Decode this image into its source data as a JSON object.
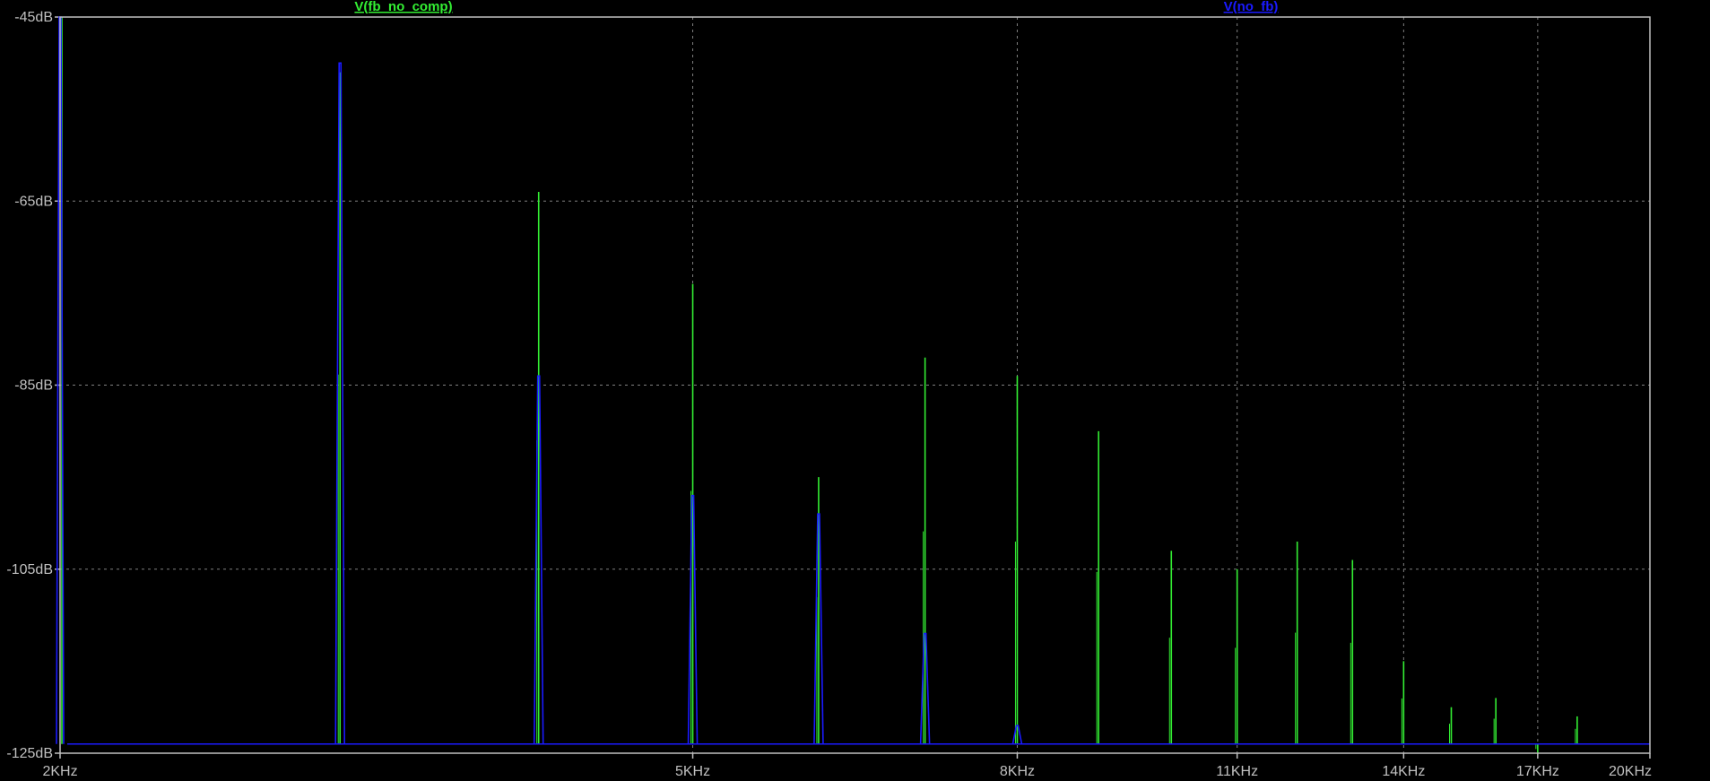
{
  "chart_data": {
    "type": "line",
    "title": "",
    "xlabel": "",
    "ylabel": "",
    "x_scale": "log",
    "xlim": [
      2000,
      20000
    ],
    "ylim": [
      -125,
      -45
    ],
    "y_unit": "dB",
    "grid": true,
    "legend_placement": "top",
    "background": "#000000",
    "grid_color": "#808080",
    "frame_color": "#c0c0c0",
    "noise_floor_db": -124,
    "x_ticks": [
      {
        "value": 2000,
        "label": "2KHz"
      },
      {
        "value": 5000,
        "label": "5KHz"
      },
      {
        "value": 8000,
        "label": "8KHz"
      },
      {
        "value": 11000,
        "label": "11KHz"
      },
      {
        "value": 14000,
        "label": "14KHz"
      },
      {
        "value": 17000,
        "label": "17KHz"
      },
      {
        "value": 20000,
        "label": "20KHz"
      }
    ],
    "y_ticks": [
      {
        "value": -45,
        "label": "-45dB"
      },
      {
        "value": -65,
        "label": "-65dB"
      },
      {
        "value": -85,
        "label": "-85dB"
      },
      {
        "value": -105,
        "label": "-105dB"
      },
      {
        "value": -125,
        "label": "-125dB"
      }
    ],
    "series": [
      {
        "name": "V(fb_no_comp)",
        "color": "#33ee33",
        "peaks": [
          {
            "x": 2000,
            "y": -45
          },
          {
            "x": 3000,
            "y": -51
          },
          {
            "x": 4000,
            "y": -64
          },
          {
            "x": 5000,
            "y": -74
          },
          {
            "x": 6000,
            "y": -95
          },
          {
            "x": 7000,
            "y": -82
          },
          {
            "x": 8000,
            "y": -84
          },
          {
            "x": 9000,
            "y": -90
          },
          {
            "x": 10000,
            "y": -103
          },
          {
            "x": 11000,
            "y": -105
          },
          {
            "x": 12000,
            "y": -102
          },
          {
            "x": 13000,
            "y": -104
          },
          {
            "x": 14000,
            "y": -115
          },
          {
            "x": 15000,
            "y": -120
          },
          {
            "x": 16000,
            "y": -119
          },
          {
            "x": 17000,
            "y": -125
          },
          {
            "x": 18000,
            "y": -121
          },
          {
            "x": 19000,
            "y": -124
          }
        ]
      },
      {
        "name": "V(no_fb)",
        "color": "#1a1aff",
        "peaks": [
          {
            "x": 2000,
            "y": -45
          },
          {
            "x": 3000,
            "y": -50
          },
          {
            "x": 4000,
            "y": -84
          },
          {
            "x": 5000,
            "y": -97
          },
          {
            "x": 6000,
            "y": -99
          },
          {
            "x": 7000,
            "y": -112
          },
          {
            "x": 8000,
            "y": -122
          }
        ]
      }
    ]
  }
}
